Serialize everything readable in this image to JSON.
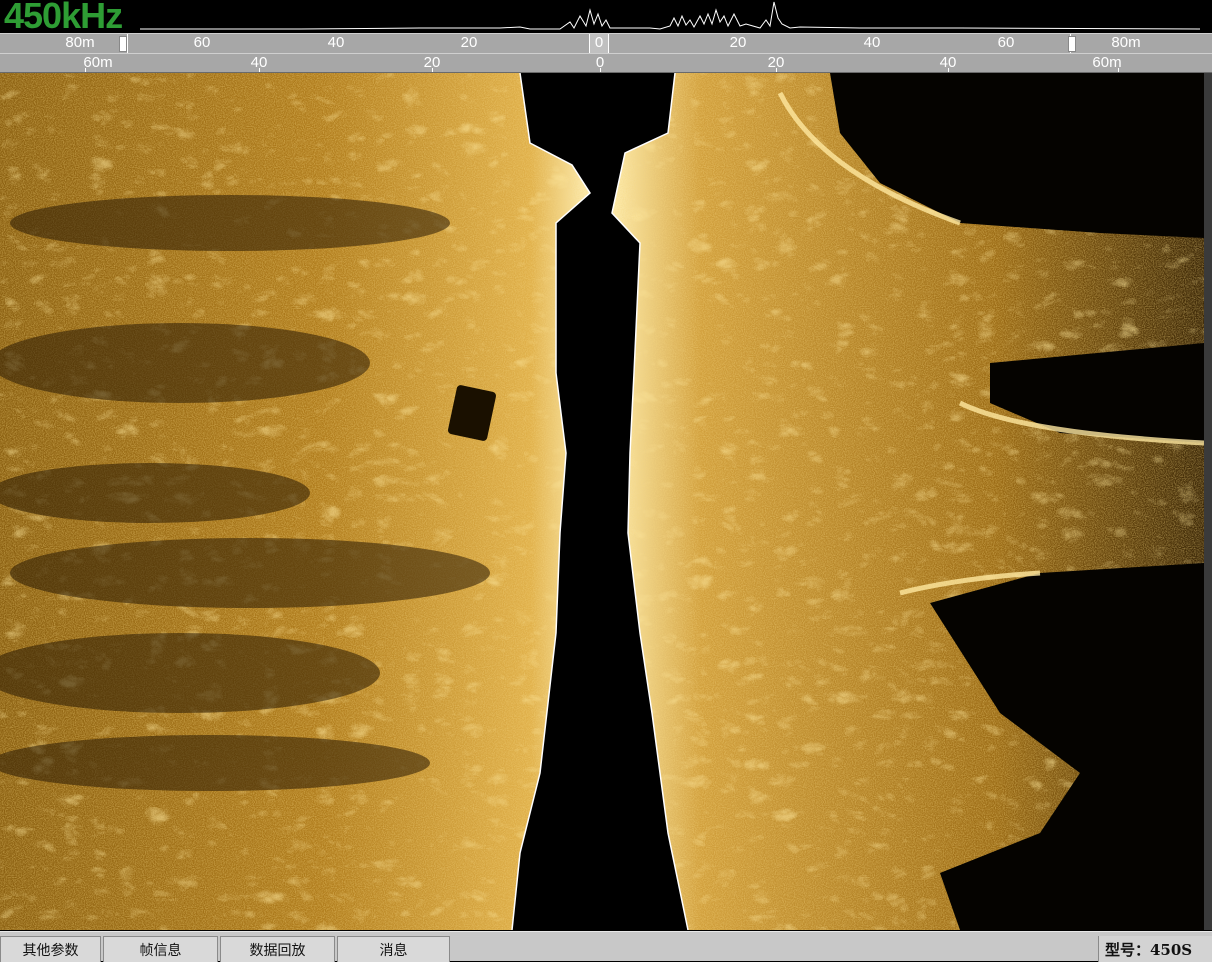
{
  "waveform": {
    "frequency_label": "450kHz"
  },
  "scale_top": {
    "left_label": "80m",
    "right_label": "80m",
    "ticks": [
      "60",
      "40",
      "20",
      "0",
      "20",
      "40",
      "60"
    ]
  },
  "scale_bottom": {
    "left_label": "60m",
    "right_label": "60m",
    "ticks": [
      "40",
      "20",
      "0",
      "20",
      "40"
    ]
  },
  "tabs": [
    "其他参数",
    "帧信息",
    "数据回放",
    "消息"
  ],
  "status": {
    "model": "型号：450S"
  },
  "colors": {
    "freq_green": "#2e9d34",
    "sonar_gold": "#c9901e",
    "scale_gray": "#a7a7a7"
  }
}
